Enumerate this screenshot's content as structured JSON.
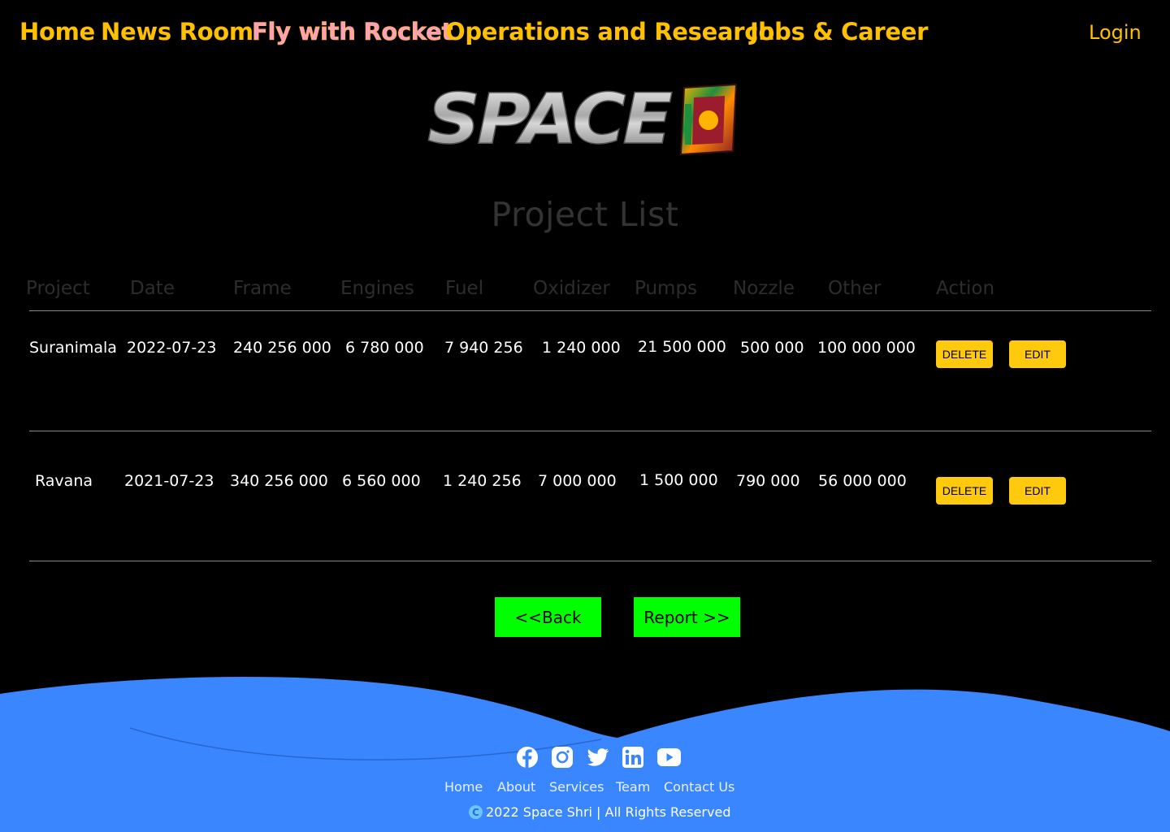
{
  "nav": {
    "items": [
      "Home",
      "News Room",
      "Fly with Rocket",
      "Operations and Research",
      "Jobs & Career"
    ],
    "active": "Fly with Rocket",
    "login": "Login"
  },
  "logo": {
    "text": "SPACE",
    "alt": "Space Shri logo"
  },
  "page_title": "Project List",
  "table": {
    "headers": [
      "Project",
      "Date",
      "Frame",
      "Engines",
      "Fuel",
      "Oxidizer",
      "Pumps",
      "Nozzle",
      "Other",
      "Action"
    ],
    "rows": [
      {
        "project": "Suranimala",
        "date": "2022-07-23",
        "frame": "240 256 000",
        "engines": "6 780 000",
        "fuel": "7 940 256",
        "oxidizer": "1 240 000",
        "pumps": "21 500 000",
        "nozzle": "500 000",
        "other": "100 000 000",
        "delete": "DELETE",
        "edit": "EDIT"
      },
      {
        "project": "Ravana",
        "date": "2021-07-23",
        "frame": "340 256 000",
        "engines": "6 560 000",
        "fuel": "1 240 256",
        "oxidizer": "7 000 000",
        "pumps": "1 500 000",
        "nozzle": "790 000",
        "other": "56 000 000",
        "delete": "DELETE",
        "edit": "EDIT"
      }
    ]
  },
  "buttons": {
    "back": "<<Back",
    "report": "Report >>"
  },
  "colors": {
    "nav": "#ffc000",
    "action_button": "#ffc90e",
    "green_button": "#00ff00",
    "footer": "#3a86ff"
  },
  "footer": {
    "social": [
      "facebook-icon",
      "instagram-icon",
      "twitter-icon",
      "linkedin-icon",
      "youtube-icon"
    ],
    "links": [
      "Home",
      "About",
      "Services",
      "Team",
      "Contact Us"
    ],
    "copyright_symbol": "C",
    "copyright": "2022 Space Shri | All Rights Reserved"
  }
}
